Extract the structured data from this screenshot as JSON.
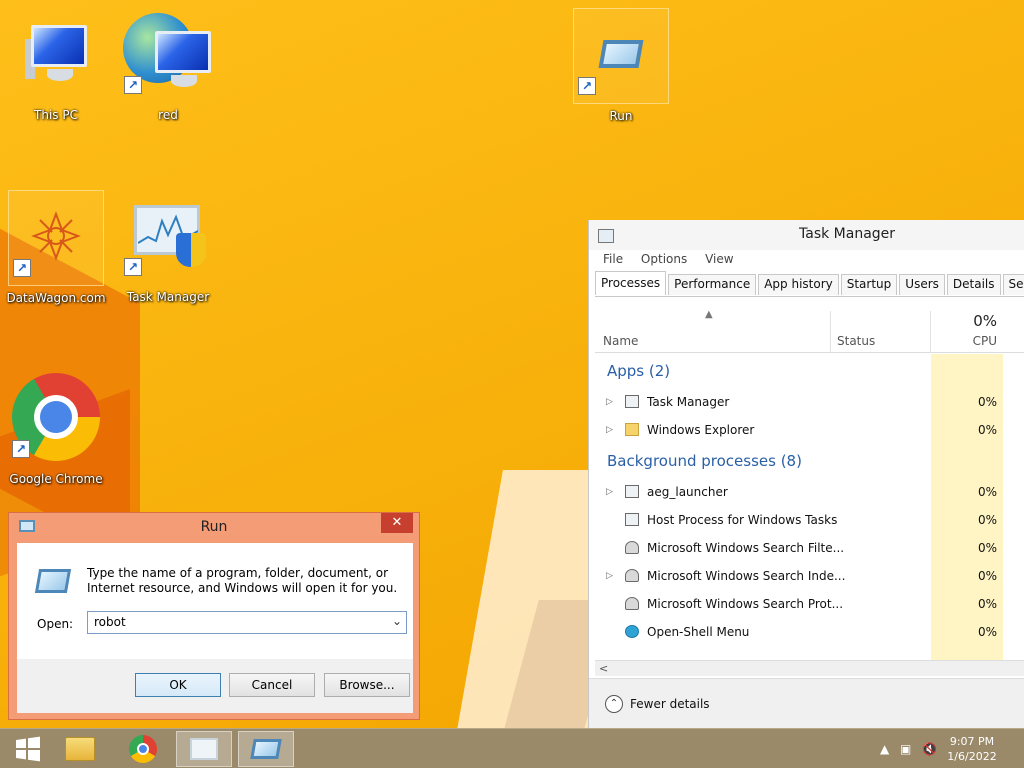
{
  "desktop": {
    "icons": [
      {
        "label": "This PC"
      },
      {
        "label": "red"
      },
      {
        "label": "Run"
      },
      {
        "label": "DataWagon.com"
      },
      {
        "label": "Task Manager"
      },
      {
        "label": "Google Chrome"
      }
    ]
  },
  "run_dialog": {
    "title": "Run",
    "close_glyph": "✕",
    "description": "Type the name of a program, folder, document, or Internet resource, and Windows will open it for you.",
    "open_label": "Open:",
    "open_value": "robot",
    "ok_label": "OK",
    "cancel_label": "Cancel",
    "browse_label": "Browse..."
  },
  "task_manager": {
    "title": "Task Manager",
    "menu": [
      "File",
      "Options",
      "View"
    ],
    "tabs": [
      "Processes",
      "Performance",
      "App history",
      "Startup",
      "Users",
      "Details",
      "Services"
    ],
    "active_tab": "Processes",
    "columns": {
      "name": "Name",
      "status": "Status",
      "cpu_total": "0%",
      "cpu": "CPU"
    },
    "groups": [
      {
        "title": "Apps (2)",
        "rows": [
          {
            "name": "Task Manager",
            "cpu": "0%",
            "expandable": true,
            "icon": "taskmgr-icon"
          },
          {
            "name": "Windows Explorer",
            "cpu": "0%",
            "expandable": true,
            "icon": "folder-icon"
          }
        ]
      },
      {
        "title": "Background processes (8)",
        "rows": [
          {
            "name": "aeg_launcher",
            "cpu": "0%",
            "expandable": true,
            "icon": "window-icon"
          },
          {
            "name": "Host Process for Windows Tasks",
            "cpu": "0%",
            "expandable": false,
            "icon": "window-icon"
          },
          {
            "name": "Microsoft Windows Search Filte...",
            "cpu": "0%",
            "expandable": false,
            "icon": "user-icon"
          },
          {
            "name": "Microsoft Windows Search Inde...",
            "cpu": "0%",
            "expandable": true,
            "icon": "user-icon"
          },
          {
            "name": "Microsoft Windows Search Prot...",
            "cpu": "0%",
            "expandable": false,
            "icon": "user-icon"
          },
          {
            "name": "Open-Shell Menu",
            "cpu": "0%",
            "expandable": false,
            "icon": "shell-icon"
          }
        ]
      }
    ],
    "fewer_details": "Fewer details"
  },
  "taskbar": {
    "time": "9:07 PM",
    "date": "1/6/2022"
  },
  "colors": {
    "desktop": "#f8b40c",
    "run_frame": "#f39c75",
    "group_heading": "#2a5fa7",
    "cpu_highlight": "#fff4c4",
    "taskbar": "#9a8a6a"
  }
}
